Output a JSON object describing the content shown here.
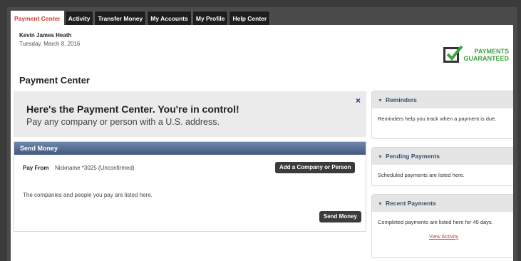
{
  "tabs": [
    "Payment Center",
    "Activity",
    "Transfer Money",
    "My Accounts",
    "My Profile",
    "Help Center"
  ],
  "user": {
    "name": "Kevin James Heath",
    "date": "Tuesday, March 8, 2016"
  },
  "badge": {
    "line1": "PAYMENTS",
    "line2": "GUARANTEED"
  },
  "page_title": "Payment Center",
  "hero": {
    "heading": "Here's the Payment Center. You're in control!",
    "subheading": "Pay any company or person with a U.S. address.",
    "close": "×"
  },
  "send_money": {
    "header": "Send Money",
    "pay_from_label": "Pay From",
    "pay_from_value": "Nickname *3025 (Unconfirmed)",
    "add_button": "Add a Company or Person",
    "info": "The companies and people you pay are listed here.",
    "send_button": "Send Money"
  },
  "sidebar": {
    "reminders": {
      "title": "Reminders",
      "text": "Reminders help you track when a payment is due."
    },
    "pending": {
      "title": "Pending Payments",
      "text": "Scheduled payments are listed here."
    },
    "recent": {
      "title": "Recent Payments",
      "text": "Completed payments are listed here for 45 days.",
      "link": "View Activity"
    }
  }
}
